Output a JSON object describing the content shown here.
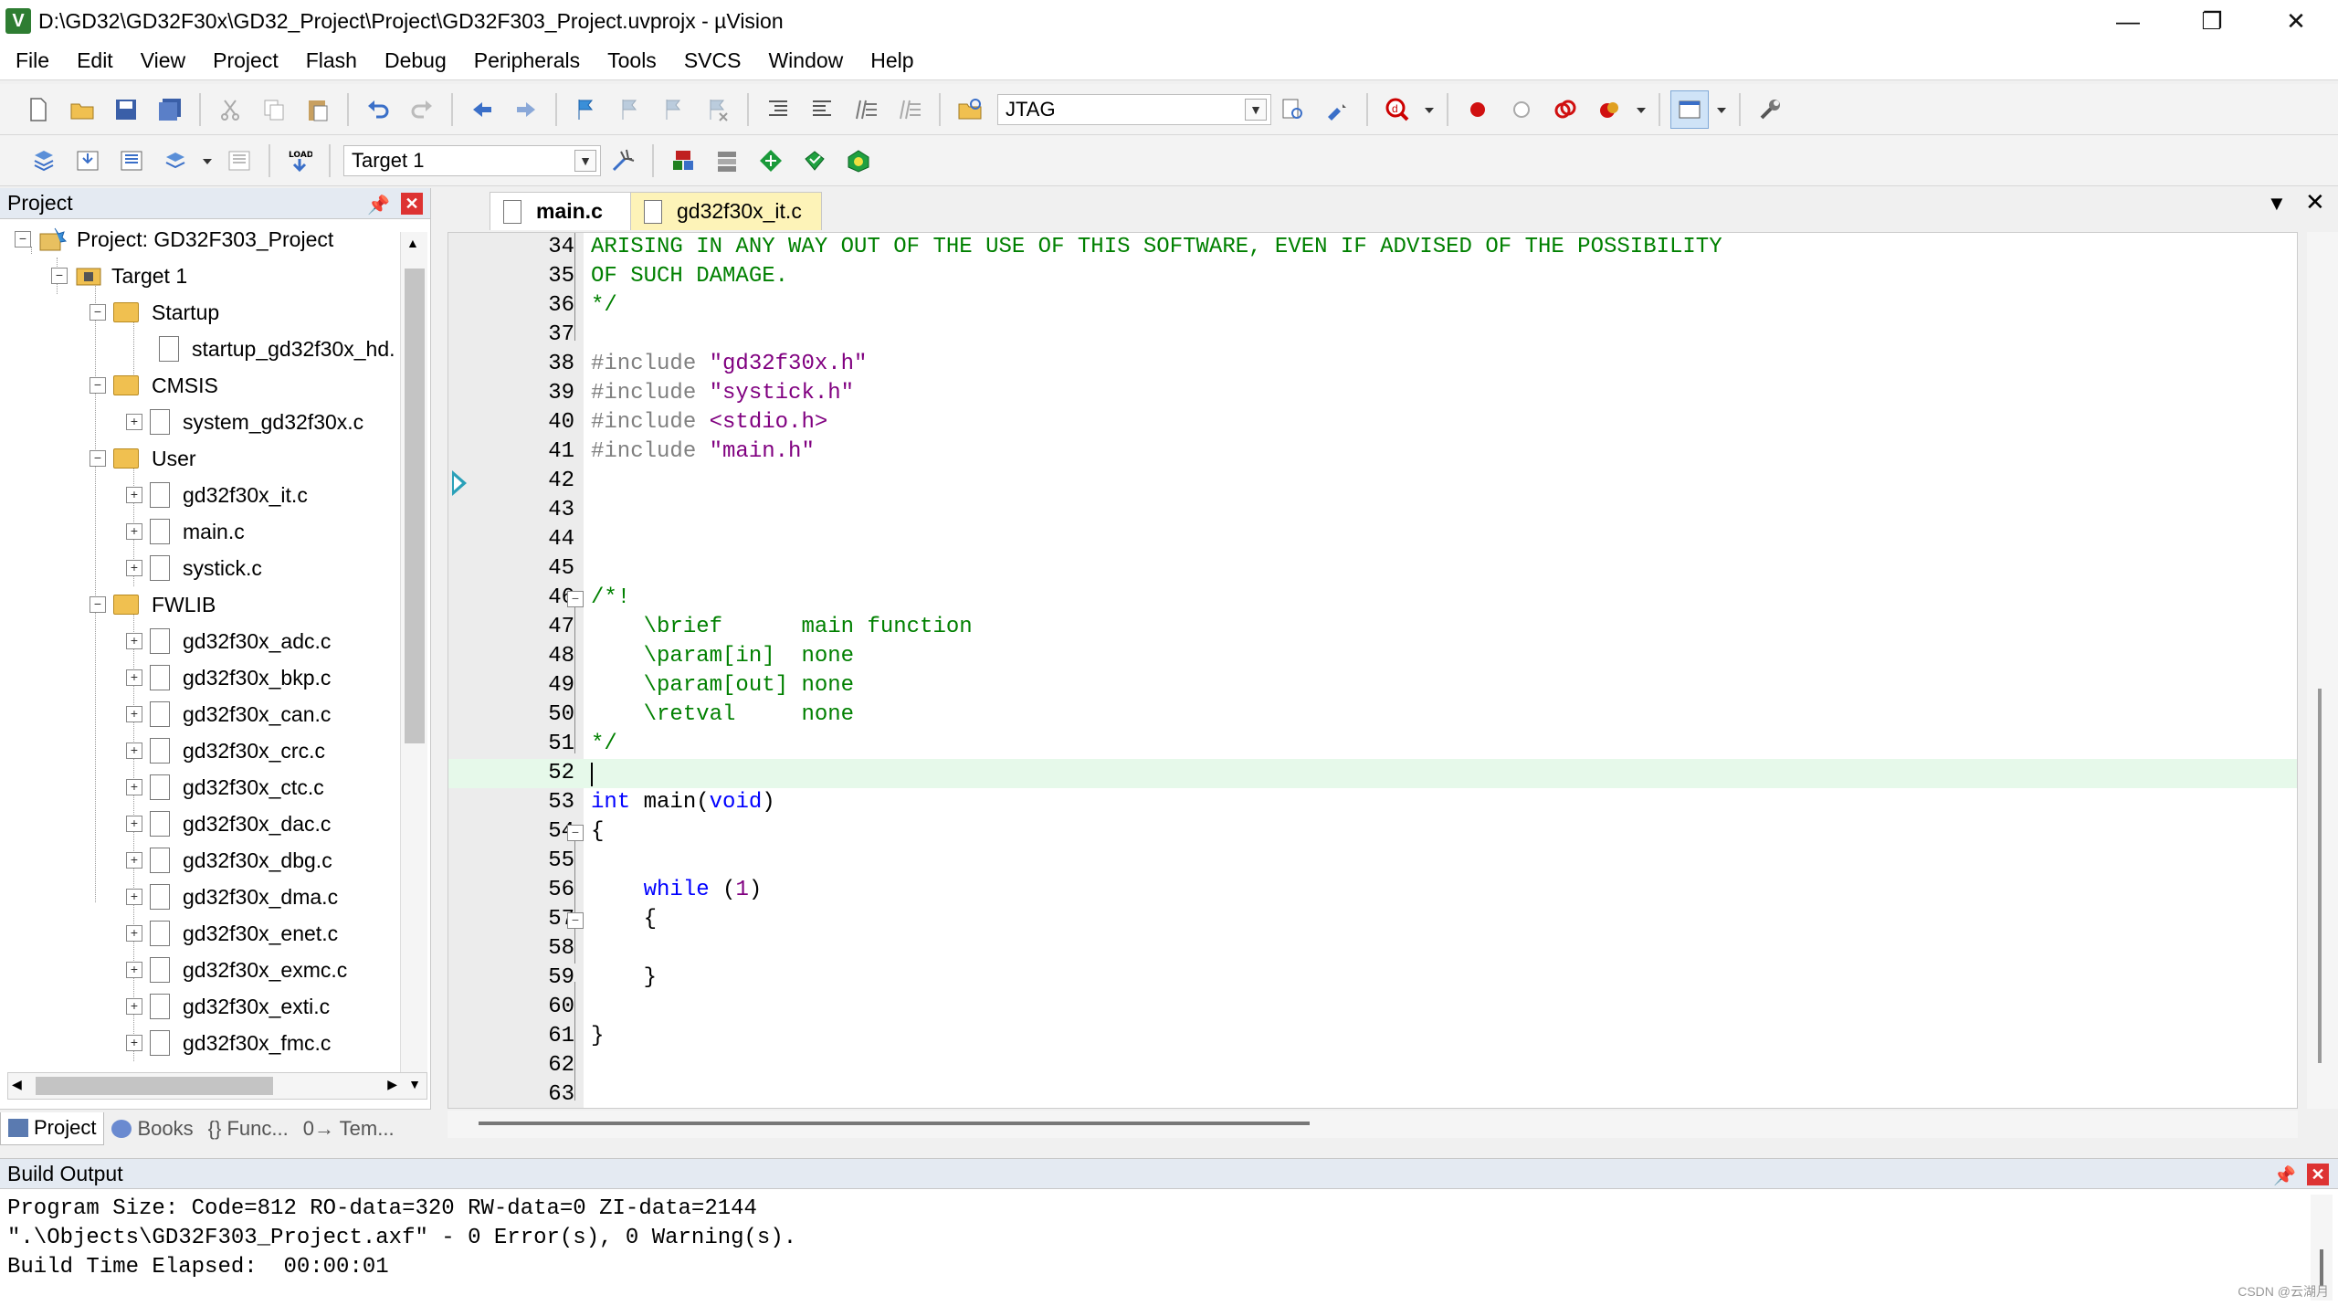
{
  "window": {
    "title": "D:\\GD32\\GD32F30x\\GD32_Project\\Project\\GD32F303_Project.uvprojx - µVision",
    "icon_letter": "V",
    "minimize": "—",
    "maximize": "❐",
    "close": "✕"
  },
  "menu": [
    "File",
    "Edit",
    "View",
    "Project",
    "Flash",
    "Debug",
    "Peripherals",
    "Tools",
    "SVCS",
    "Window",
    "Help"
  ],
  "toolbar": {
    "jtag_label": "JTAG",
    "target_value": "Target 1",
    "load_label": "LOAD"
  },
  "project_panel": {
    "title": "Project",
    "pin": "📌",
    "close": "✕",
    "tree": {
      "root": "Project: GD32F303_Project",
      "target": "Target 1",
      "groups": [
        {
          "name": "Startup",
          "files": [
            "startup_gd32f30x_hd."
          ]
        },
        {
          "name": "CMSIS",
          "files": [
            "system_gd32f30x.c"
          ]
        },
        {
          "name": "User",
          "files": [
            "gd32f30x_it.c",
            "main.c",
            "systick.c"
          ]
        },
        {
          "name": "FWLIB",
          "files": [
            "gd32f30x_adc.c",
            "gd32f30x_bkp.c",
            "gd32f30x_can.c",
            "gd32f30x_crc.c",
            "gd32f30x_ctc.c",
            "gd32f30x_dac.c",
            "gd32f30x_dbg.c",
            "gd32f30x_dma.c",
            "gd32f30x_enet.c",
            "gd32f30x_exmc.c",
            "gd32f30x_exti.c",
            "gd32f30x_fmc.c"
          ]
        }
      ]
    },
    "tabs": [
      "Project",
      "Books",
      "{} Func...",
      "0→ Tem..."
    ]
  },
  "editor": {
    "tabs": [
      {
        "label": "main.c",
        "active": true
      },
      {
        "label": "gd32f30x_it.c",
        "active": false
      }
    ],
    "current_line": 52,
    "lines": [
      {
        "n": "34",
        "parts": [
          [
            "c-com",
            "ARISING IN ANY WAY OUT OF THE USE OF THIS SOFTWARE, EVEN IF ADVISED OF THE POSSIBILITY"
          ]
        ]
      },
      {
        "n": "35",
        "parts": [
          [
            "c-com",
            "OF SUCH DAMAGE."
          ]
        ]
      },
      {
        "n": "36",
        "parts": [
          [
            "c-com",
            "*/"
          ]
        ]
      },
      {
        "n": "37",
        "parts": []
      },
      {
        "n": "38",
        "parts": [
          [
            "c-pp",
            "#include "
          ],
          [
            "c-str",
            "\"gd32f30x.h\""
          ]
        ]
      },
      {
        "n": "39",
        "parts": [
          [
            "c-pp",
            "#include "
          ],
          [
            "c-str",
            "\"systick.h\""
          ]
        ]
      },
      {
        "n": "40",
        "parts": [
          [
            "c-pp",
            "#include "
          ],
          [
            "c-str",
            "<stdio.h>"
          ]
        ]
      },
      {
        "n": "41",
        "parts": [
          [
            "c-pp",
            "#include "
          ],
          [
            "c-str",
            "\"main.h\""
          ]
        ]
      },
      {
        "n": "42",
        "parts": []
      },
      {
        "n": "43",
        "parts": []
      },
      {
        "n": "44",
        "parts": []
      },
      {
        "n": "45",
        "parts": []
      },
      {
        "n": "46",
        "parts": [
          [
            "c-com",
            "/*!"
          ]
        ]
      },
      {
        "n": "47",
        "parts": [
          [
            "c-com",
            "    \\brief      main function"
          ]
        ]
      },
      {
        "n": "48",
        "parts": [
          [
            "c-com",
            "    \\param[in]  none"
          ]
        ]
      },
      {
        "n": "49",
        "parts": [
          [
            "c-com",
            "    \\param[out] none"
          ]
        ]
      },
      {
        "n": "50",
        "parts": [
          [
            "c-com",
            "    \\retval     none"
          ]
        ]
      },
      {
        "n": "51",
        "parts": [
          [
            "c-com",
            "*/"
          ]
        ]
      },
      {
        "n": "52",
        "parts": []
      },
      {
        "n": "53",
        "parts": [
          [
            "c-kw",
            "int"
          ],
          [
            "c-txt",
            " main"
          ],
          [
            "c-txt",
            "("
          ],
          [
            "c-kw",
            "void"
          ],
          [
            "c-txt",
            ")"
          ]
        ]
      },
      {
        "n": "54",
        "parts": [
          [
            "c-txt",
            "{"
          ]
        ]
      },
      {
        "n": "55",
        "parts": []
      },
      {
        "n": "56",
        "parts": [
          [
            "c-txt",
            "    "
          ],
          [
            "c-kw",
            "while"
          ],
          [
            "c-txt",
            " ("
          ],
          [
            "c-num",
            "1"
          ],
          [
            "c-txt",
            ")"
          ]
        ]
      },
      {
        "n": "57",
        "parts": [
          [
            "c-txt",
            "    {"
          ]
        ]
      },
      {
        "n": "58",
        "parts": []
      },
      {
        "n": "59",
        "parts": [
          [
            "c-txt",
            "    }"
          ]
        ]
      },
      {
        "n": "60",
        "parts": []
      },
      {
        "n": "61",
        "parts": [
          [
            "c-txt",
            "}"
          ]
        ]
      },
      {
        "n": "62",
        "parts": []
      },
      {
        "n": "63",
        "parts": []
      }
    ]
  },
  "build_output": {
    "title": "Build Output",
    "pin": "📌",
    "close": "✕",
    "lines": [
      "Program Size: Code=812 RO-data=320 RW-data=0 ZI-data=2144",
      "\".\\Objects\\GD32F303_Project.axf\" - 0 Error(s), 0 Warning(s).",
      "Build Time Elapsed:  00:00:01"
    ]
  },
  "watermark": "CSDN @云湖月",
  "colors": {
    "comment": "#008000",
    "keyword": "#0000ff",
    "string": "#800080",
    "current_line_bg": "#e6f9ea",
    "panel_header": "#e4eaf2"
  }
}
